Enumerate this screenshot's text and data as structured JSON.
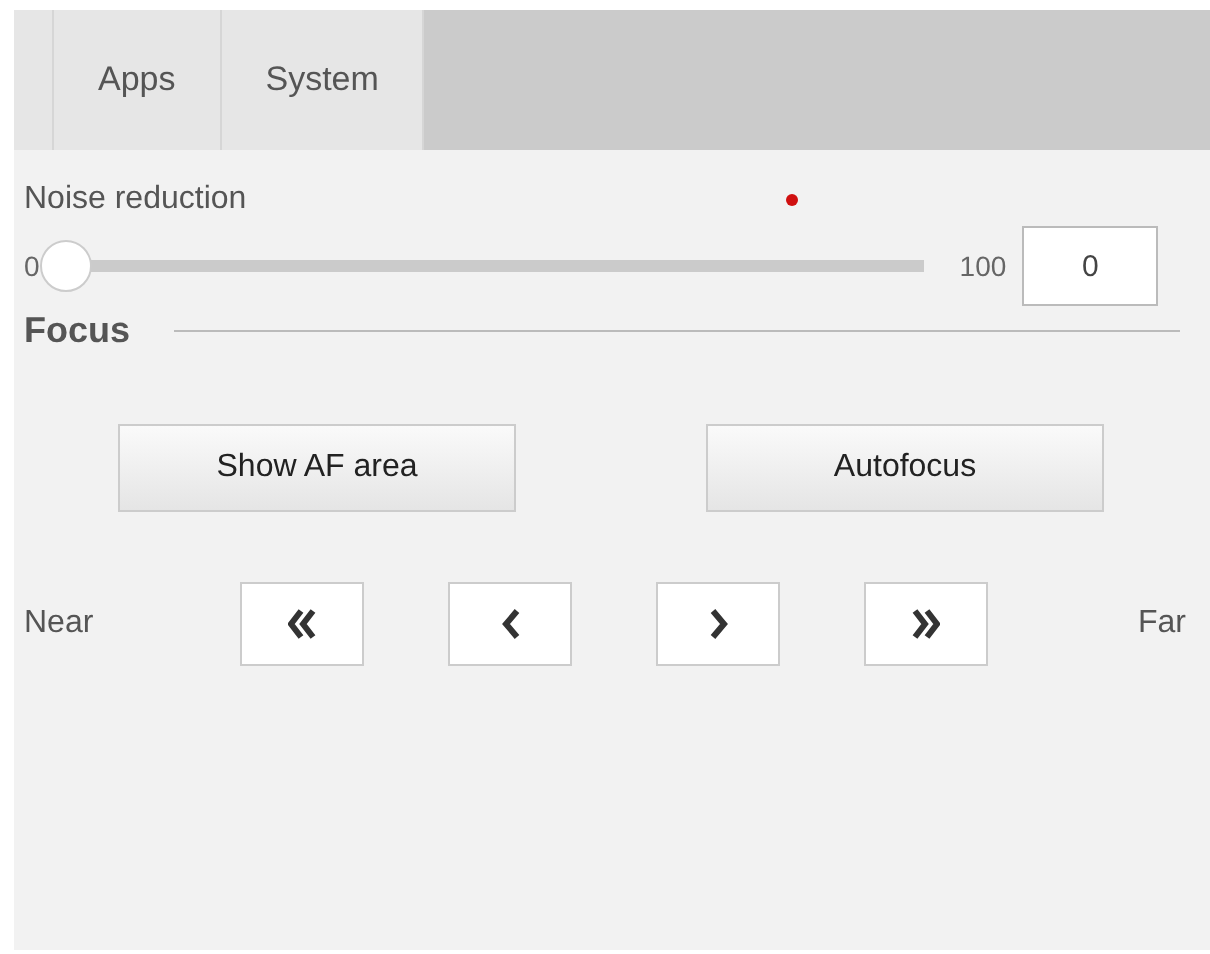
{
  "tabs": [
    {
      "label": "Apps",
      "selected": false
    },
    {
      "label": "System",
      "selected": false
    }
  ],
  "noise_reduction": {
    "label": "Noise reduction",
    "modified": true,
    "min": "0",
    "max": "100",
    "level": 0,
    "value": "0"
  },
  "focus": {
    "title": "Focus",
    "buttons": [
      "Show AF area",
      "Autofocus"
    ],
    "near_label": "Near",
    "far_label": "Far",
    "steps": [
      {
        "kind": "fast-back"
      },
      {
        "kind": "back"
      },
      {
        "kind": "forward"
      },
      {
        "kind": "fast-forward"
      }
    ]
  }
}
